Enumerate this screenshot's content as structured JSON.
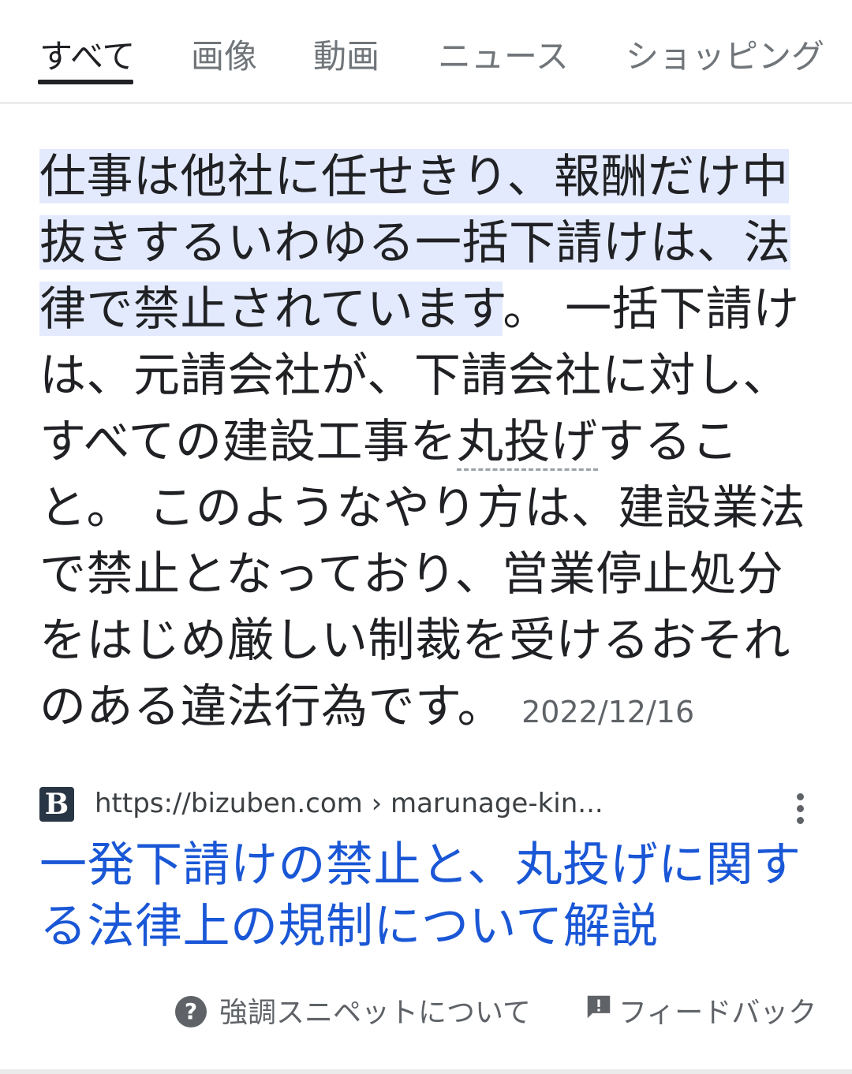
{
  "tabs": {
    "all": "すべて",
    "images": "画像",
    "videos": "動画",
    "news": "ニュース",
    "shopping": "ショッピング"
  },
  "snippet": {
    "highlighted": "仕事は他社に任せきり、報酬だけ中抜きするいわゆる一括下請けは、法律で禁止されています",
    "text_1": "。 一括下請けは、元請会社が、下請会社に対し、すべての建設工事を",
    "term": "丸投げ",
    "text_2": "すること。 このようなやり方は、建設業法で禁止となっており、営業停止処分をはじめ厳しい制裁を受けるおそれのある違法行為です。",
    "date": "2022/12/16"
  },
  "source": {
    "favicon_letter": "B",
    "url": "https://bizuben.com › marunage-kin..."
  },
  "result": {
    "title": "一発下請けの禁止と、丸投げに関する法律上の規制について解説"
  },
  "footer": {
    "about_snippets": "強調スニペットについて",
    "help_glyph": "?",
    "feedback": "フィードバック"
  },
  "colors": {
    "highlight": "#e3eafd",
    "link": "#1a57d6"
  }
}
